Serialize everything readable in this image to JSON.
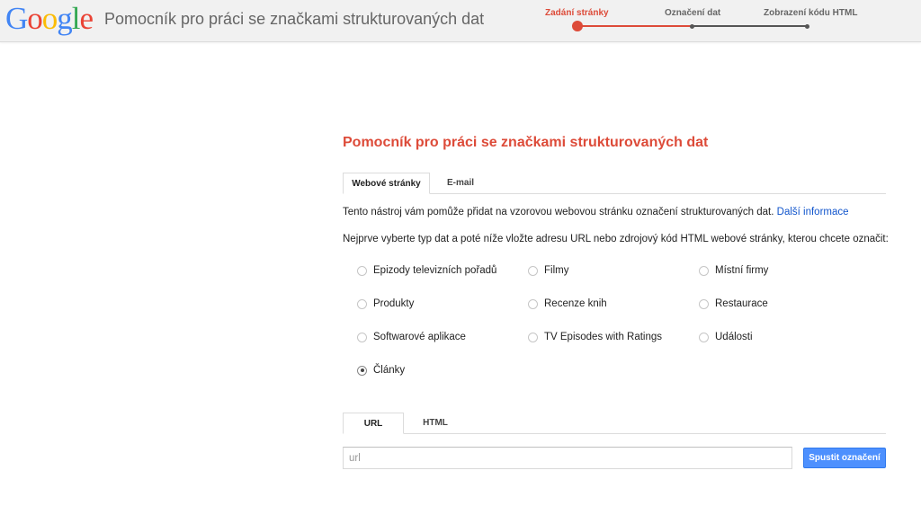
{
  "header": {
    "logo": [
      "G",
      "o",
      "o",
      "g",
      "l",
      "e"
    ],
    "logo_colors": [
      "#4285f4",
      "#ea4335",
      "#fbbc05",
      "#4285f4",
      "#34a853",
      "#ea4335"
    ],
    "app_title": "Pomocník pro práci se značkami strukturovaných dat",
    "steps": [
      {
        "label": "Zadání stránky",
        "active": true
      },
      {
        "label": "Označení dat",
        "active": false
      },
      {
        "label": "Zobrazení kódu HTML",
        "active": false
      }
    ]
  },
  "main": {
    "title": "Pomocník pro práci se značkami strukturovaných dat",
    "tabs": [
      {
        "label": "Webové stránky",
        "active": true
      },
      {
        "label": "E-mail",
        "active": false
      }
    ],
    "intro_text": "Tento nástroj vám pomůže přidat na vzorovou webovou stránku označení strukturovaných dat.",
    "intro_link": "Další informace",
    "instruction": "Nejprve vyberte typ dat a poté níže vložte adresu URL nebo zdrojový kód HTML webové stránky, kterou chcete označit:",
    "data_types": [
      {
        "label": "Epizody televizních pořadů",
        "checked": false
      },
      {
        "label": "Filmy",
        "checked": false
      },
      {
        "label": "Místní firmy",
        "checked": false
      },
      {
        "label": "Produkty",
        "checked": false
      },
      {
        "label": "Recenze knih",
        "checked": false
      },
      {
        "label": "Restaurace",
        "checked": false
      },
      {
        "label": "Softwarové aplikace",
        "checked": false
      },
      {
        "label": "TV Episodes with Ratings",
        "checked": false
      },
      {
        "label": "Události",
        "checked": false
      },
      {
        "label": "Články",
        "checked": true
      }
    ],
    "source_tabs": [
      {
        "label": "URL",
        "active": true
      },
      {
        "label": "HTML",
        "active": false
      }
    ],
    "url_placeholder": "url",
    "url_value": "",
    "start_button": "Spustit označení"
  },
  "colors": {
    "accent_red": "#dd4b39",
    "link_blue": "#1155cc",
    "button_blue": "#4d90fe"
  }
}
